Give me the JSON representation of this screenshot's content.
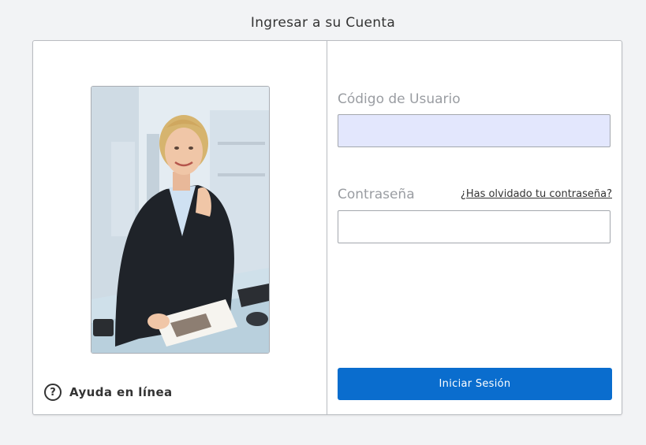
{
  "page": {
    "title": "Ingresar a su Cuenta"
  },
  "left": {
    "help_label": "Ayuda en línea",
    "help_icon": "question-circle-icon",
    "help_icon_glyph": "?"
  },
  "login": {
    "username_label": "Código de Usuario",
    "username_value": "",
    "password_label": "Contraseña",
    "password_value": "",
    "forgot_link": "¿Has olvidado tu contraseña?",
    "submit_label": "Iniciar Sesión"
  },
  "colors": {
    "accent": "#0a6dce",
    "username_field_bg": "#e3e7fd",
    "page_bg": "#f2f3f5"
  }
}
